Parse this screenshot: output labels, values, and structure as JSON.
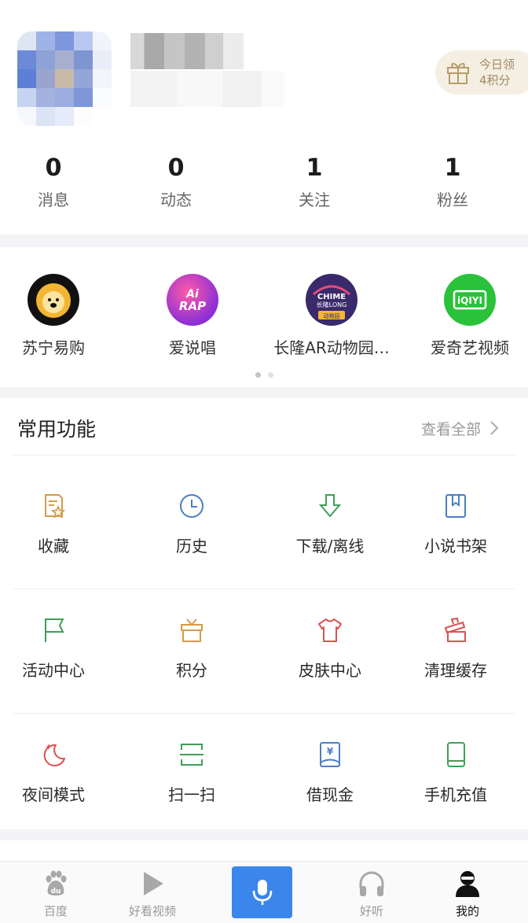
{
  "profile": {
    "daily_reward": {
      "line1": "今日领",
      "line2": "4积分"
    }
  },
  "stats": [
    {
      "value": "0",
      "label": "消息"
    },
    {
      "value": "0",
      "label": "动态"
    },
    {
      "value": "1",
      "label": "关注"
    },
    {
      "value": "1",
      "label": "粉丝"
    }
  ],
  "apps": [
    {
      "name": "苏宁易购",
      "icon": "suning-lion-icon"
    },
    {
      "name": "爱说唱",
      "icon": "ai-rap-icon",
      "logo_text": [
        "Ai",
        "RAP"
      ]
    },
    {
      "name": "长隆AR动物园…",
      "icon": "chimelong-zoo-icon",
      "logo_text": [
        "CHIME",
        "长隆LONG",
        "动物园"
      ]
    },
    {
      "name": "爱奇艺视频",
      "icon": "iqiyi-icon",
      "logo_text": "iQIYI"
    }
  ],
  "carousel": {
    "pages": 2,
    "active": 0
  },
  "functions": {
    "title": "常用功能",
    "view_all": "查看全部",
    "items": [
      {
        "label": "收藏",
        "icon": "favorite-icon",
        "color": "#d59b4a"
      },
      {
        "label": "历史",
        "icon": "clock-icon",
        "color": "#4a7fc1"
      },
      {
        "label": "下载/离线",
        "icon": "download-icon",
        "color": "#3f9e5a"
      },
      {
        "label": "小说书架",
        "icon": "bookshelf-icon",
        "color": "#4a7fc1"
      },
      {
        "label": "活动中心",
        "icon": "flag-icon",
        "color": "#3f9e5a"
      },
      {
        "label": "积分",
        "icon": "gift-icon",
        "color": "#d59b4a"
      },
      {
        "label": "皮肤中心",
        "icon": "shirt-icon",
        "color": "#d9534f"
      },
      {
        "label": "清理缓存",
        "icon": "clean-icon",
        "color": "#d9534f"
      },
      {
        "label": "夜间模式",
        "icon": "moon-icon",
        "color": "#d9534f"
      },
      {
        "label": "扫一扫",
        "icon": "scan-icon",
        "color": "#3f9e5a"
      },
      {
        "label": "借现金",
        "icon": "cash-icon",
        "color": "#4a7fc1"
      },
      {
        "label": "手机充值",
        "icon": "phone-recharge-icon",
        "color": "#3f9e5a"
      }
    ]
  },
  "tabbar": [
    {
      "label": "百度",
      "icon": "baidu-paw-icon"
    },
    {
      "label": "好看视频",
      "icon": "play-icon"
    },
    {
      "label": "",
      "icon": "microphone-icon",
      "color": "#3b86ea"
    },
    {
      "label": "好听",
      "icon": "headphones-icon"
    },
    {
      "label": "我的",
      "icon": "user-icon",
      "active": true
    }
  ]
}
